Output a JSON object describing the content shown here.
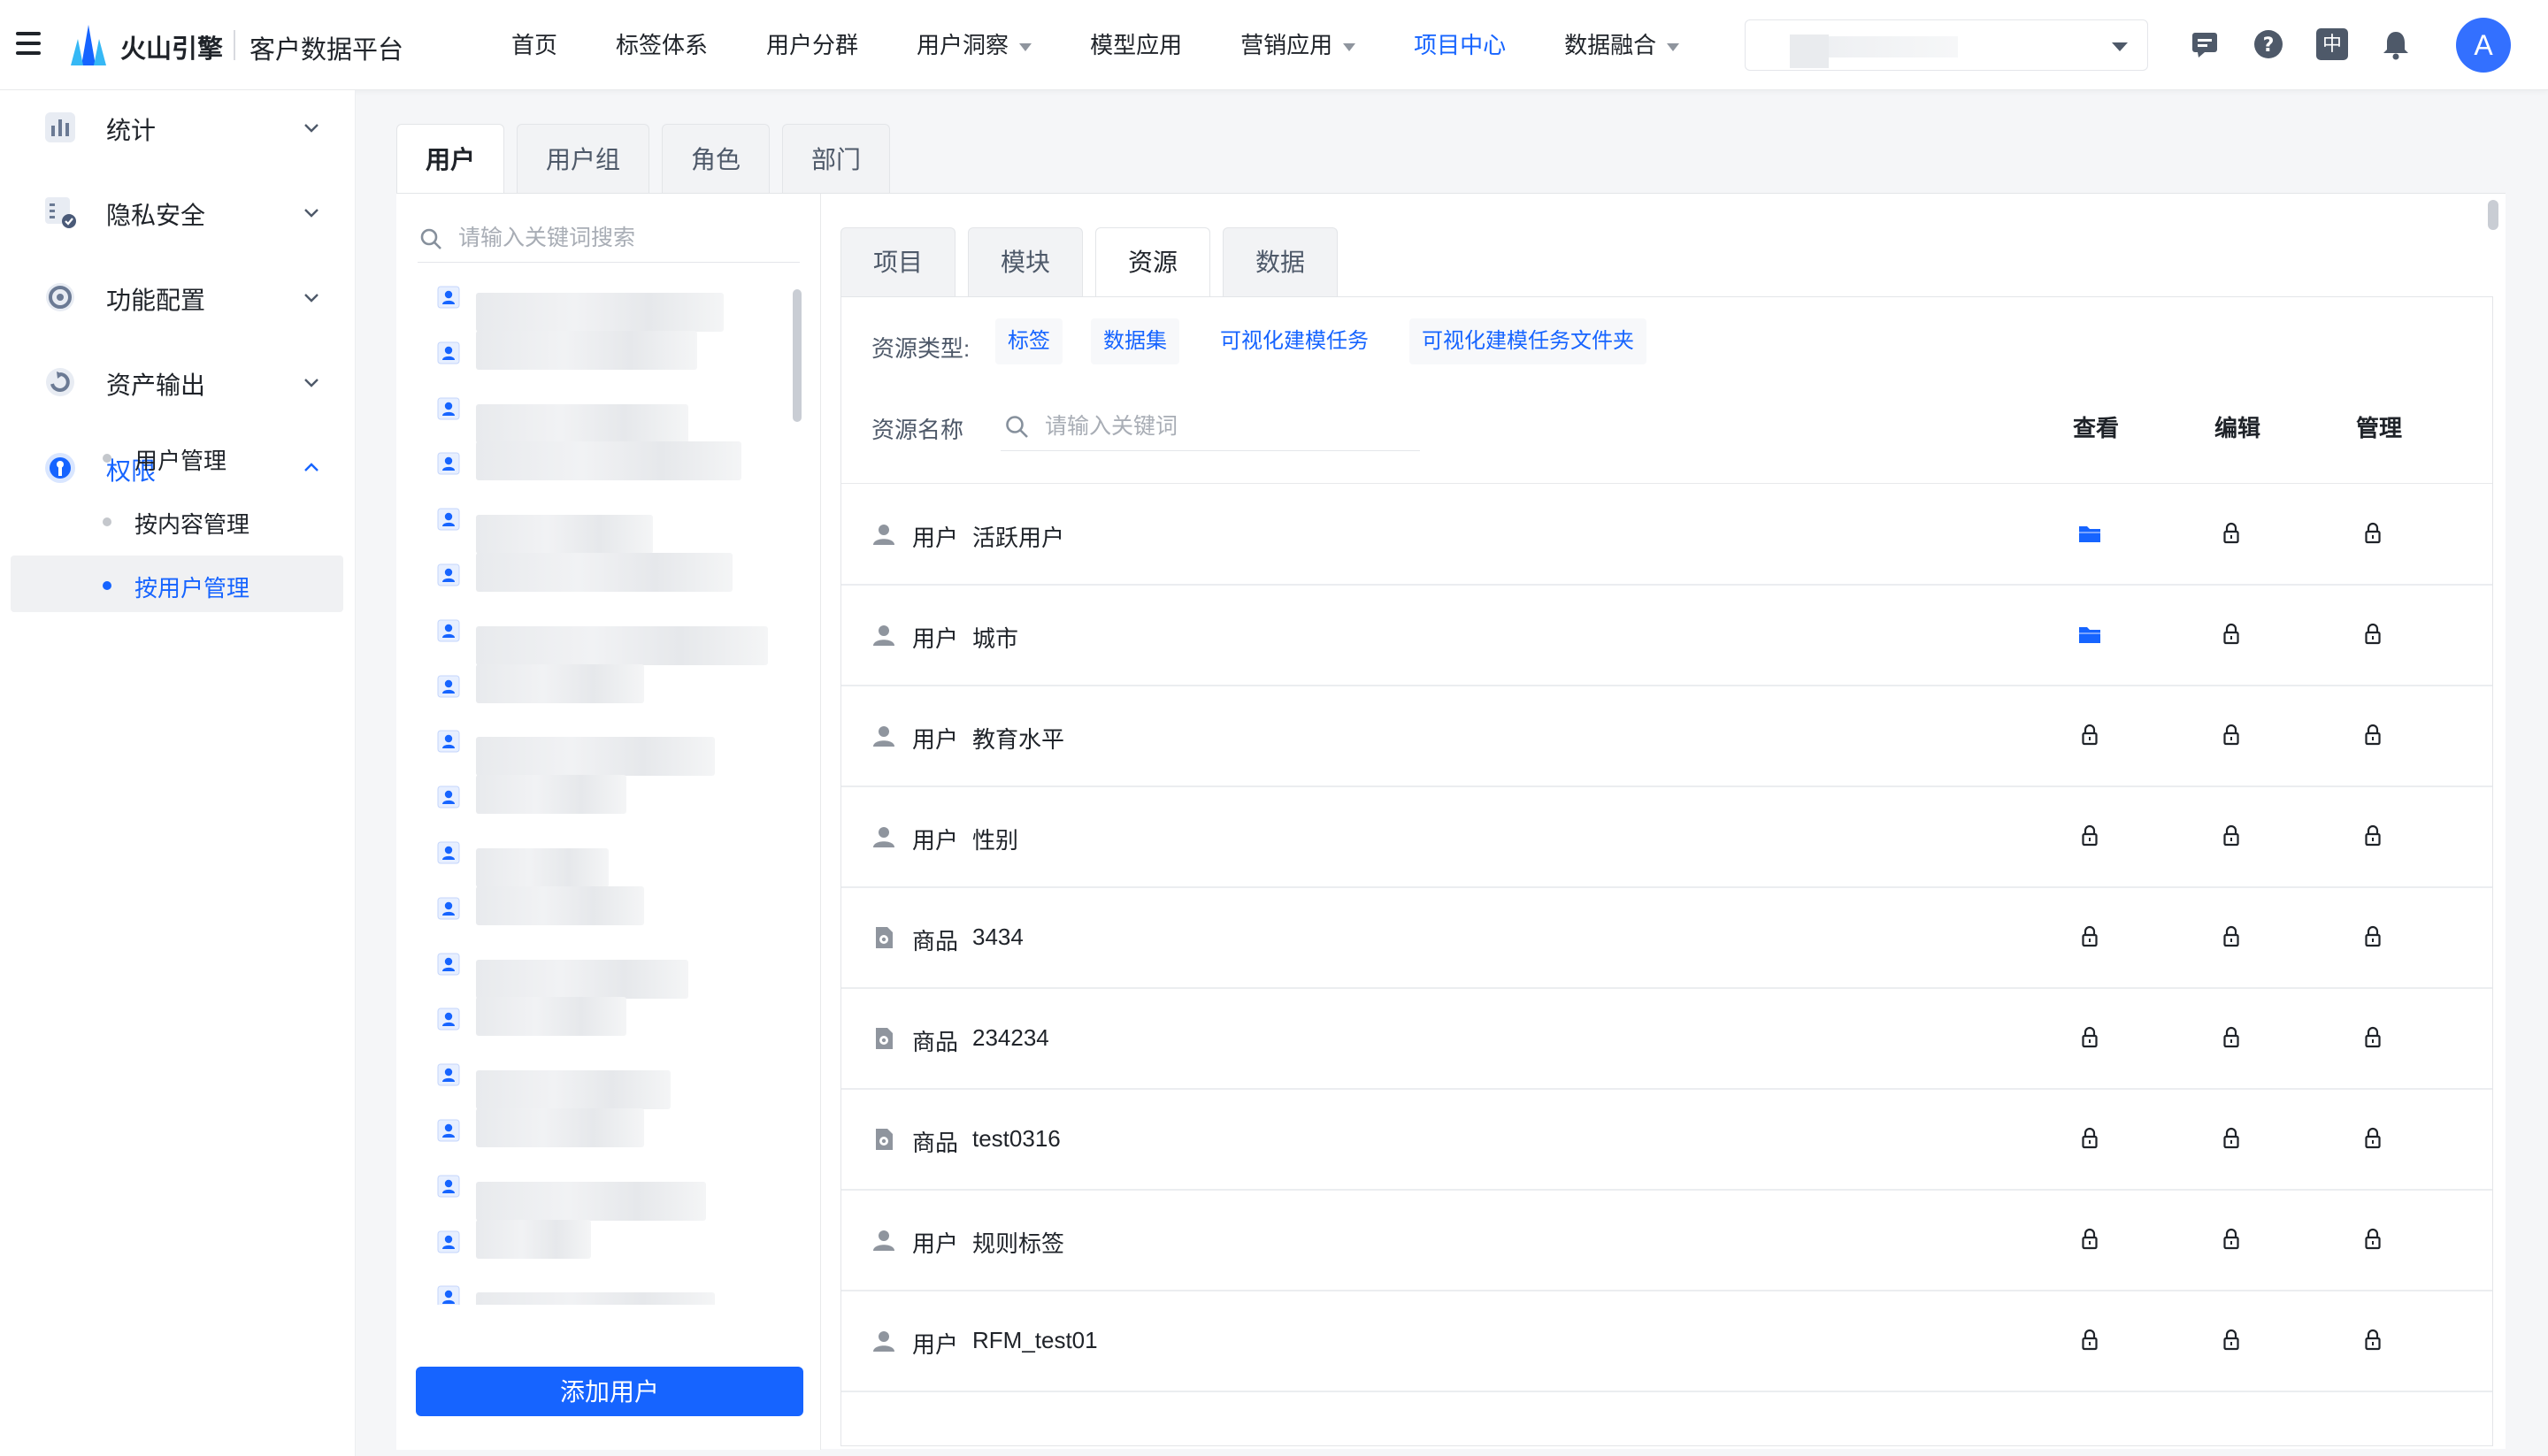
{
  "header": {
    "brand": "火山引擎",
    "product": "客户数据平台",
    "nav": [
      {
        "label": "首页",
        "has_caret": false,
        "active": false
      },
      {
        "label": "标签体系",
        "has_caret": false,
        "active": false
      },
      {
        "label": "用户分群",
        "has_caret": false,
        "active": false
      },
      {
        "label": "用户洞察",
        "has_caret": true,
        "active": false
      },
      {
        "label": "模型应用",
        "has_caret": false,
        "active": false
      },
      {
        "label": "营销应用",
        "has_caret": true,
        "active": false
      },
      {
        "label": "项目中心",
        "has_caret": false,
        "active": true
      },
      {
        "label": "数据融合",
        "has_caret": true,
        "active": false
      }
    ],
    "lang_label": "中",
    "avatar_initial": "A",
    "icons": [
      "menu-icon",
      "message-icon",
      "help-icon",
      "language-icon",
      "bell-icon"
    ]
  },
  "sidebar": {
    "items": [
      {
        "label": "统计",
        "icon": "chart-icon",
        "expanded": false
      },
      {
        "label": "隐私安全",
        "icon": "privacy-icon",
        "expanded": false
      },
      {
        "label": "功能配置",
        "icon": "settings-icon",
        "expanded": false
      },
      {
        "label": "资产输出",
        "icon": "export-icon",
        "expanded": false
      },
      {
        "label": "权限",
        "icon": "permission-icon",
        "expanded": true,
        "active": true
      }
    ],
    "sub_items": [
      {
        "label": "用户管理",
        "active": false
      },
      {
        "label": "按内容管理",
        "active": false
      },
      {
        "label": "按用户管理",
        "active": true
      }
    ]
  },
  "main": {
    "tabs": [
      {
        "label": "用户",
        "active": true
      },
      {
        "label": "用户组",
        "active": false
      },
      {
        "label": "角色",
        "active": false
      },
      {
        "label": "部门",
        "active": false
      }
    ],
    "user_search_placeholder": "请输入关键词搜索",
    "add_user_label": "添加用户",
    "sub_tabs": [
      {
        "label": "项目",
        "active": false
      },
      {
        "label": "模块",
        "active": false
      },
      {
        "label": "资源",
        "active": true
      },
      {
        "label": "数据",
        "active": false
      }
    ],
    "resource_type_label": "资源类型:",
    "resource_types": [
      {
        "label": "标签",
        "selected": true
      },
      {
        "label": "数据集",
        "selected": true
      },
      {
        "label": "可视化建模任务",
        "selected": false
      },
      {
        "label": "可视化建模任务文件夹",
        "selected": true
      }
    ],
    "resource_name_label": "资源名称",
    "keyword_placeholder": "请输入关键词",
    "columns": [
      "查看",
      "编辑",
      "管理"
    ],
    "rows": [
      {
        "type": "用户",
        "name": "活跃用户",
        "icon": "user-icon",
        "view": "folder",
        "edit": "lock",
        "manage": "lock"
      },
      {
        "type": "用户",
        "name": "城市",
        "icon": "user-icon",
        "view": "folder",
        "edit": "lock",
        "manage": "lock"
      },
      {
        "type": "用户",
        "name": "教育水平",
        "icon": "user-icon",
        "view": "lock",
        "edit": "lock",
        "manage": "lock"
      },
      {
        "type": "用户",
        "name": "性别",
        "icon": "user-icon",
        "view": "lock",
        "edit": "lock",
        "manage": "lock"
      },
      {
        "type": "商品",
        "name": "3434",
        "icon": "product-icon",
        "view": "lock",
        "edit": "lock",
        "manage": "lock"
      },
      {
        "type": "商品",
        "name": "234234",
        "icon": "product-icon",
        "view": "lock",
        "edit": "lock",
        "manage": "lock"
      },
      {
        "type": "商品",
        "name": "test0316",
        "icon": "product-icon",
        "view": "lock",
        "edit": "lock",
        "manage": "lock"
      },
      {
        "type": "用户",
        "name": "规则标签",
        "icon": "user-icon",
        "view": "lock",
        "edit": "lock",
        "manage": "lock"
      },
      {
        "type": "用户",
        "name": "RFM_test01",
        "icon": "user-icon",
        "view": "lock",
        "edit": "lock",
        "manage": "lock"
      }
    ]
  },
  "colors": {
    "accent": "#1664ff",
    "text": "#1f2329",
    "muted": "#4e5969"
  }
}
